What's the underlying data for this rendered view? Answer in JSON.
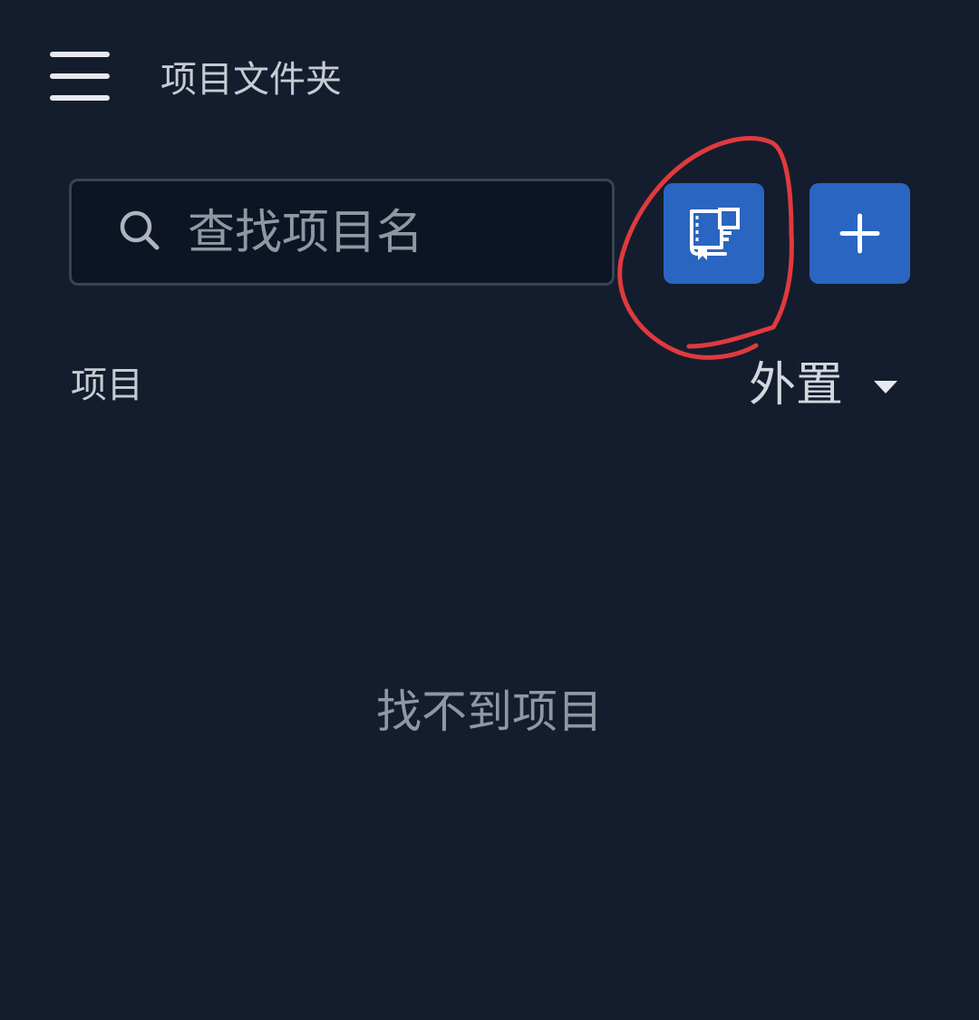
{
  "header": {
    "menu_icon": "hamburger-menu-icon",
    "title": "项目文件夹"
  },
  "search": {
    "placeholder": "查找项目名",
    "value": "",
    "icon": "search-icon"
  },
  "actions": {
    "template_icon": "template-book-icon",
    "add_icon": "plus-icon",
    "button_color": "#2a65c2"
  },
  "annotation": {
    "shape": "hand-drawn circle around template button",
    "color": "#e03a3e"
  },
  "list": {
    "section_label": "项目",
    "sort_value": "外置",
    "sort_icon": "caret-down-icon",
    "empty_message": "找不到项目"
  },
  "theme": {
    "background": "#141d2d",
    "search_background": "#0d1524",
    "text_color": "#c9ced6",
    "muted_text": "#8f97a3"
  }
}
